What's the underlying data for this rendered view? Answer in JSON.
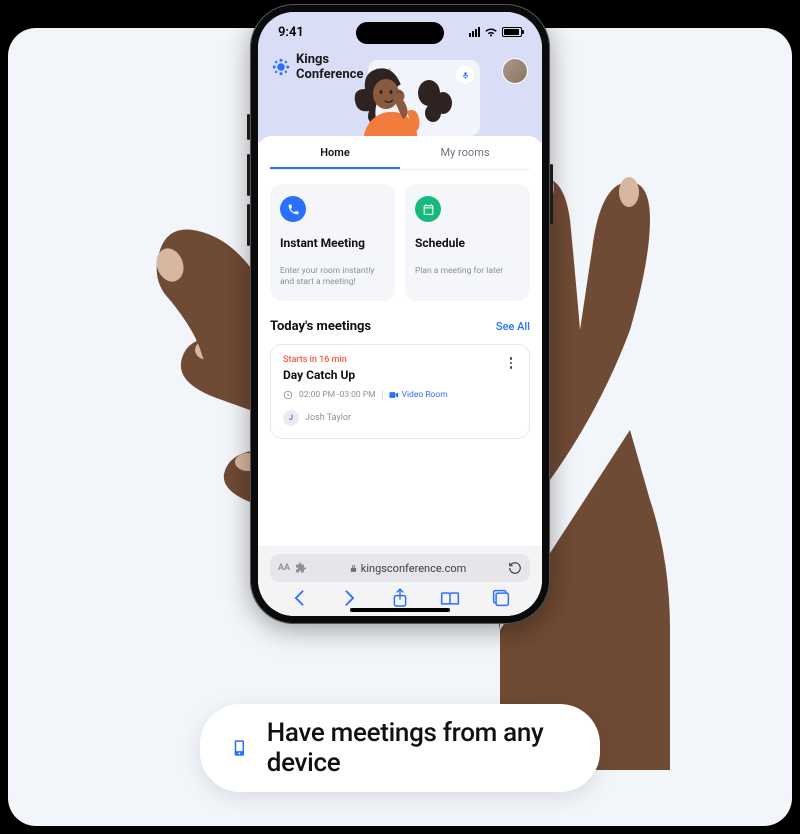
{
  "statusbar": {
    "time": "9:41"
  },
  "brand": {
    "line1": "Kings",
    "line2": "Conference"
  },
  "tabs": {
    "home": "Home",
    "rooms": "My rooms"
  },
  "cards": {
    "instant": {
      "title": "Instant Meeting",
      "desc": "Enter your room instantly and start a meeting!"
    },
    "schedule": {
      "title": "Schedule",
      "desc": "Plan a meeting for later"
    }
  },
  "today": {
    "title": "Today's meetings",
    "see_all": "See All"
  },
  "meeting": {
    "starts": "Starts in 16 min",
    "title": "Day Catch Up",
    "time": "02:00 PM -03:00 PM",
    "room": "Video Room",
    "person_initial": "J",
    "person": "Josh Taylor"
  },
  "safari": {
    "aa": "AA",
    "domain": "kingsconference.com"
  },
  "caption": "Have meetings from any device"
}
